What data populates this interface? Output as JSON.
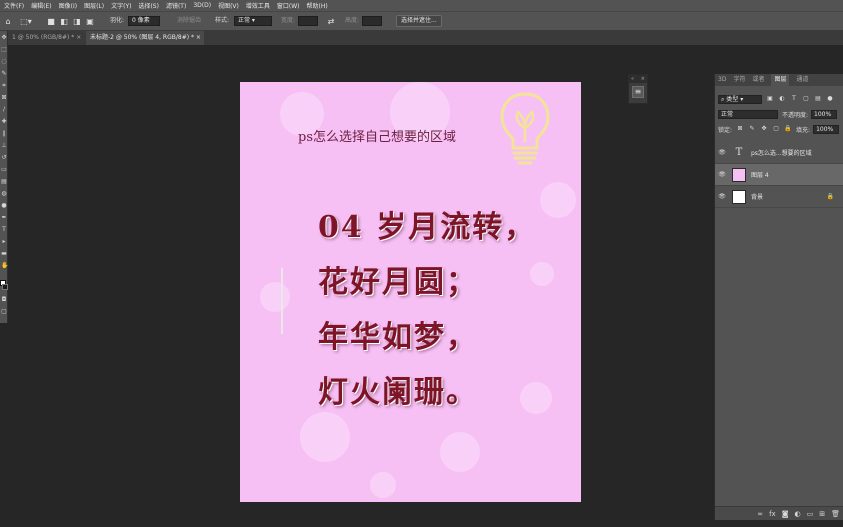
{
  "menu": [
    "文件(F)",
    "编辑(E)",
    "图像(I)",
    "图层(L)",
    "文字(Y)",
    "选择(S)",
    "滤镜(T)",
    "3D(D)",
    "视图(V)",
    "增效工具",
    "窗口(W)",
    "帮助(H)"
  ],
  "options": {
    "feather_label": "羽化:",
    "feather_value": "0 像素",
    "antialias_label": "消除锯齿",
    "style_label": "样式:",
    "style_value": "正常",
    "width_label": "宽度:",
    "height_label": "高度:",
    "select_subject_button": "选择并遮住..."
  },
  "tabs": [
    {
      "label": "1 @ 50% (RGB/8#) *",
      "close": "×"
    },
    {
      "label": "未标题-2 @ 50% (图层 4, RGB/8#) *",
      "close": "×"
    }
  ],
  "canvas": {
    "title": "ps怎么选择自己想要的区域",
    "lines": [
      "04 岁月流转，",
      "花好月圆；",
      "年华如梦，",
      "灯火阑珊。"
    ]
  },
  "panel": {
    "tabs": [
      "3D",
      "字符",
      "或者",
      "图层",
      "通道"
    ],
    "active_tab": "图层",
    "kind_filter": "类型",
    "blend_mode": "正常",
    "opacity_label": "不透明度:",
    "opacity_value": "100%",
    "lock_label": "锁定:",
    "fill_label": "填充:",
    "fill_value": "100%",
    "layers": [
      {
        "name": "ps怎么选...想要的区域",
        "type": "text",
        "visible": true,
        "selected": false,
        "locked": false
      },
      {
        "name": "图层 4",
        "type": "image",
        "visible": true,
        "selected": true,
        "locked": false
      },
      {
        "name": "背景",
        "type": "background",
        "visible": true,
        "selected": false,
        "locked": true
      }
    ]
  },
  "colors": {
    "canvas_bg": "#f7c0f5",
    "poem_text": "#7d1428",
    "title_text": "#6b1f3e",
    "bulb_stroke": "#f3e39a"
  },
  "icons": [
    "home-icon",
    "marquee-icon",
    "eye-icon",
    "lock-icon",
    "lightbulb-icon",
    "link-icon",
    "fx-icon",
    "mask-icon",
    "adjustment-icon",
    "folder-icon",
    "new-layer-icon",
    "trash-icon"
  ]
}
